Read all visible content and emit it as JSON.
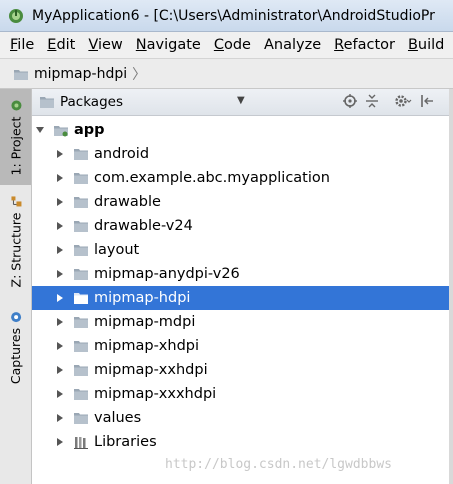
{
  "window": {
    "title": "MyApplication6 - [C:\\Users\\Administrator\\AndroidStudioPr",
    "app_icon": "android-studio-icon"
  },
  "menu": {
    "items": [
      {
        "label": "File",
        "mnemonic": "F",
        "rest": "ile"
      },
      {
        "label": "Edit",
        "mnemonic": "E",
        "rest": "dit"
      },
      {
        "label": "View",
        "mnemonic": "V",
        "rest": "iew"
      },
      {
        "label": "Navigate",
        "mnemonic": "N",
        "rest": "avigate"
      },
      {
        "label": "Code",
        "mnemonic": "C",
        "rest": "ode"
      },
      {
        "label": "Analyze",
        "mnemonic": "",
        "rest": "Analyze"
      },
      {
        "label": "Refactor",
        "mnemonic": "R",
        "rest": "efactor"
      },
      {
        "label": "Build",
        "mnemonic": "B",
        "rest": "uild"
      }
    ]
  },
  "breadcrumb": {
    "folder": "mipmap-hdpi",
    "chevron": "〉"
  },
  "toolstrip": {
    "tabs": [
      {
        "label": "1: Project",
        "icon": "project-icon",
        "active": true
      },
      {
        "label": "Z: Structure",
        "icon": "structure-icon",
        "active": false
      },
      {
        "label": "Captures",
        "icon": "captures-icon",
        "active": false
      }
    ]
  },
  "panel": {
    "view_label": "Packages",
    "dropdown_glyph": "▼",
    "icons": [
      "locate-icon",
      "collapse-all-icon",
      "settings-gear-icon",
      "hide-panel-icon"
    ]
  },
  "tree": {
    "root": {
      "label": "app",
      "expanded": true
    },
    "items": [
      {
        "label": "android",
        "icon": "package-folder-icon",
        "selected": false
      },
      {
        "label": "com.example.abc.myapplication",
        "icon": "package-folder-icon",
        "selected": false
      },
      {
        "label": "drawable",
        "icon": "package-folder-icon",
        "selected": false
      },
      {
        "label": "drawable-v24",
        "icon": "package-folder-icon",
        "selected": false
      },
      {
        "label": "layout",
        "icon": "package-folder-icon",
        "selected": false
      },
      {
        "label": "mipmap-anydpi-v26",
        "icon": "package-folder-icon",
        "selected": false
      },
      {
        "label": "mipmap-hdpi",
        "icon": "package-folder-icon",
        "selected": true
      },
      {
        "label": "mipmap-mdpi",
        "icon": "package-folder-icon",
        "selected": false
      },
      {
        "label": "mipmap-xhdpi",
        "icon": "package-folder-icon",
        "selected": false
      },
      {
        "label": "mipmap-xxhdpi",
        "icon": "package-folder-icon",
        "selected": false
      },
      {
        "label": "mipmap-xxxhdpi",
        "icon": "package-folder-icon",
        "selected": false
      },
      {
        "label": "values",
        "icon": "package-folder-icon",
        "selected": false
      },
      {
        "label": "Libraries",
        "icon": "libraries-icon",
        "selected": false
      }
    ]
  },
  "watermark": "http://blog.csdn.net/lgwdbbws",
  "colors": {
    "selection": "#3375d7",
    "folder": "#9aa7b4"
  }
}
